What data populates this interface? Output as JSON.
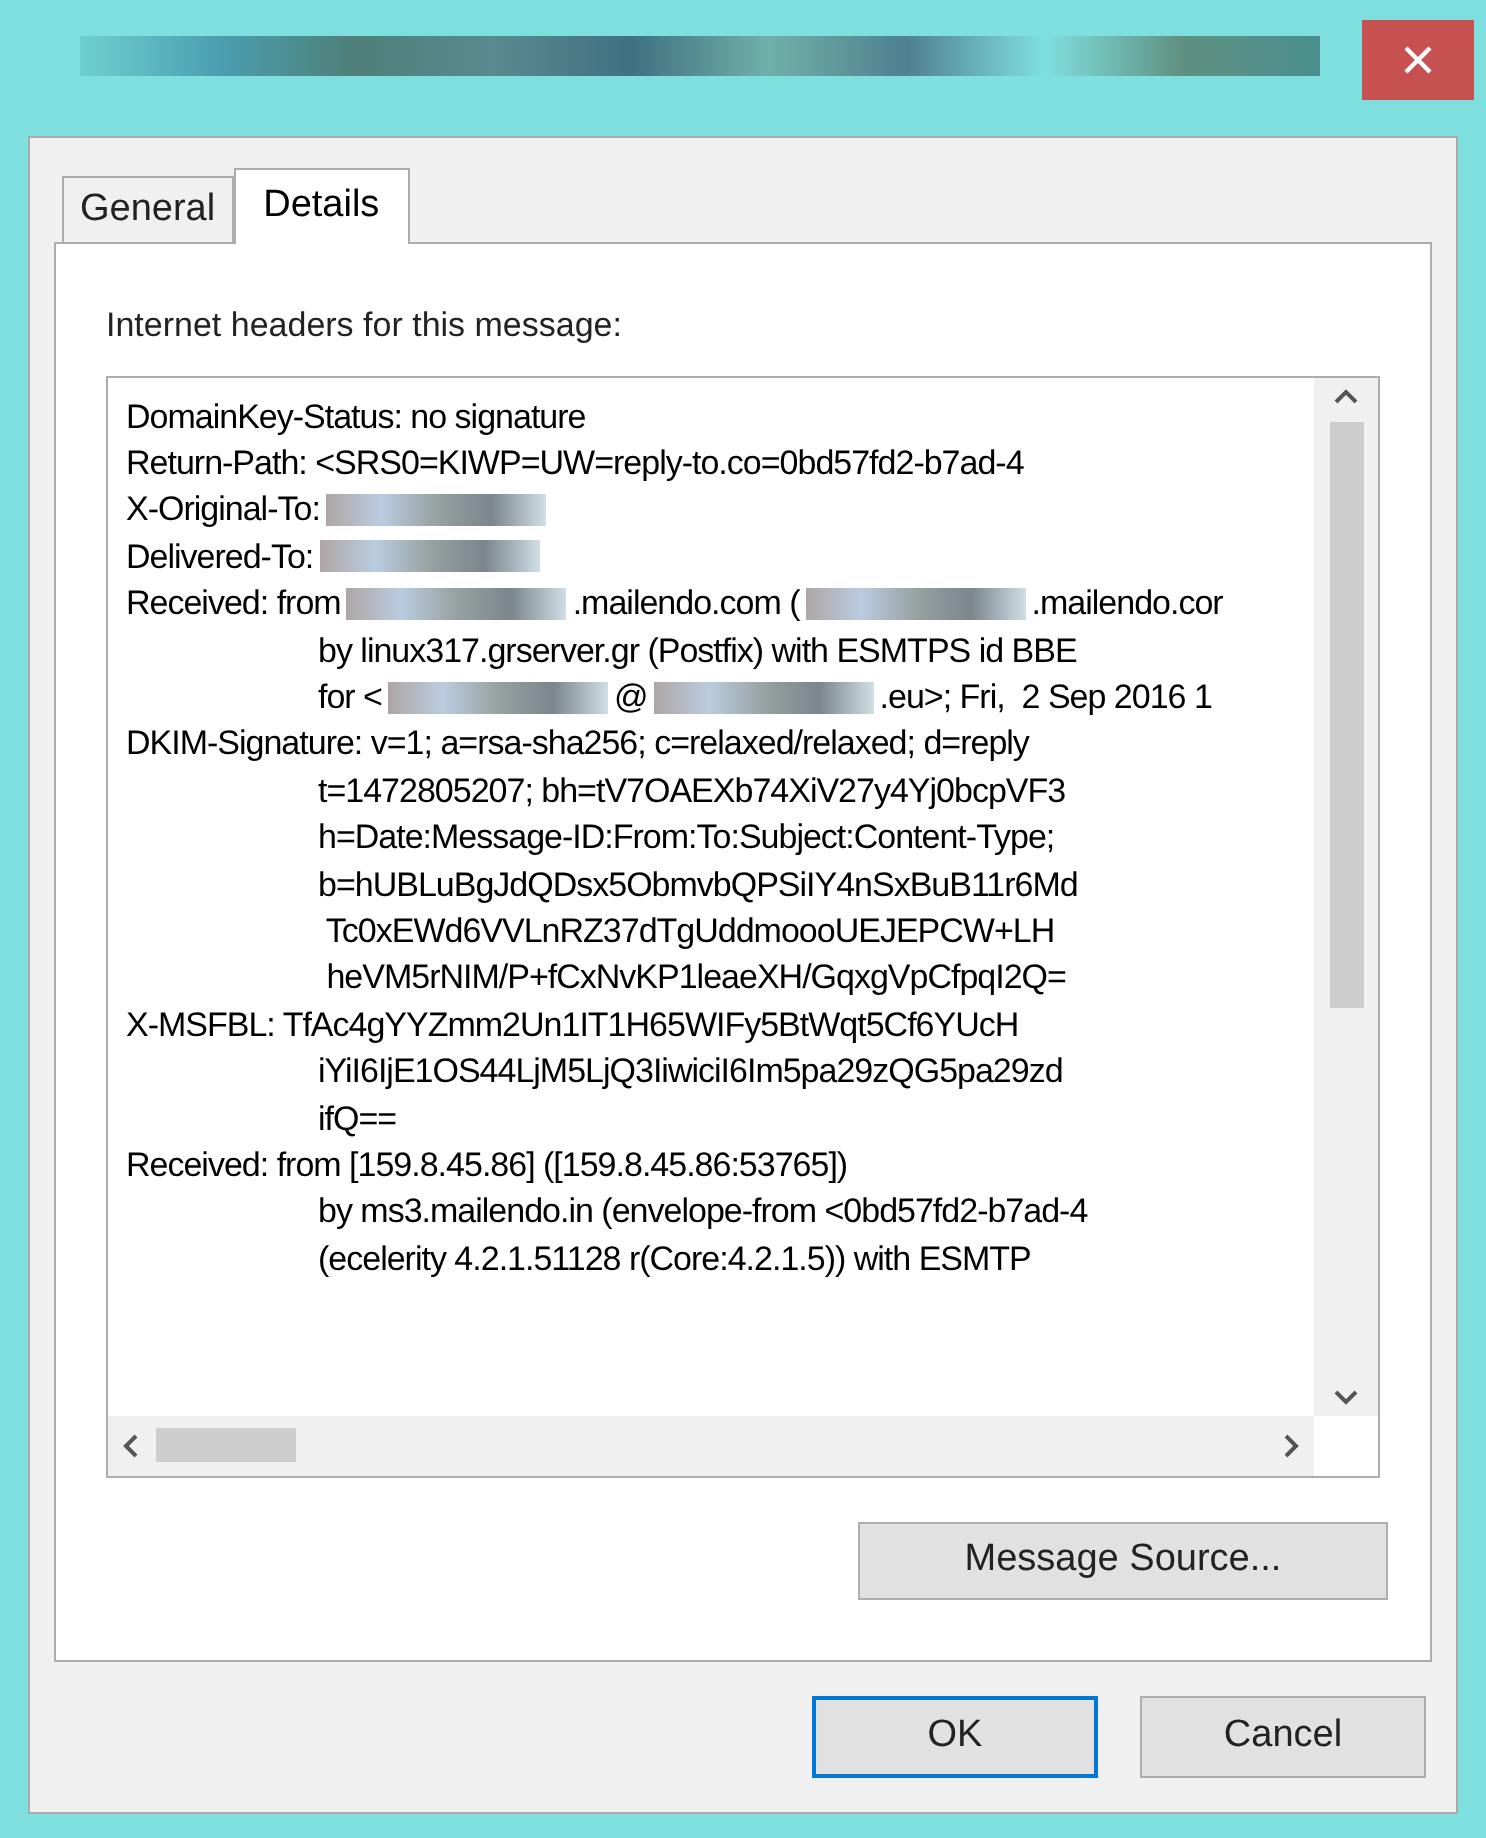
{
  "window": {
    "title_redacted": true
  },
  "tabs": [
    {
      "label": "General",
      "selected": false
    },
    {
      "label": "Details",
      "selected": true
    }
  ],
  "headers_label": "Internet headers for this message:",
  "headers": [
    {
      "lines": [
        [
          {
            "kind": "text",
            "text": "DomainKey-Status: no signature"
          }
        ]
      ]
    },
    {
      "lines": [
        [
          {
            "kind": "text",
            "text": "Return-Path: <SRS0=KIWP=UW=reply-to.co=0bd57fd2-b7ad-4"
          }
        ]
      ]
    },
    {
      "lines": [
        [
          {
            "kind": "text",
            "text": "X-Original-To:"
          },
          {
            "kind": "redacted"
          }
        ]
      ]
    },
    {
      "lines": [
        [
          {
            "kind": "text",
            "text": "Delivered-To:"
          },
          {
            "kind": "redacted"
          }
        ]
      ]
    },
    {
      "lines": [
        [
          {
            "kind": "text",
            "text": "Received: from"
          },
          {
            "kind": "redacted"
          },
          {
            "kind": "text",
            "text": ".mailendo.com ("
          },
          {
            "kind": "redacted"
          },
          {
            "kind": "text",
            "text": ".mailendo.cor"
          }
        ],
        [
          {
            "kind": "text",
            "text": "by linux317.grserver.gr (Postfix) with ESMTPS id BBE"
          }
        ],
        [
          {
            "kind": "text",
            "text": "for <"
          },
          {
            "kind": "redacted"
          },
          {
            "kind": "text",
            "text": "@"
          },
          {
            "kind": "redacted"
          },
          {
            "kind": "text",
            "text": ".eu>; Fri,  2 Sep 2016 1"
          }
        ]
      ]
    },
    {
      "lines": [
        [
          {
            "kind": "text",
            "text": "DKIM-Signature: v=1; a=rsa-sha256; c=relaxed/relaxed; d=reply"
          }
        ],
        [
          {
            "kind": "text",
            "text": "t=1472805207; bh=tV7OAEXb74XiV27y4Yj0bcpVF3"
          }
        ],
        [
          {
            "kind": "text",
            "text": "h=Date:Message-ID:From:To:Subject:Content-Type;"
          }
        ],
        [
          {
            "kind": "text",
            "text": "b=hUBLuBgJdQDsx5ObmvbQPSiIY4nSxBuB11r6Md"
          }
        ],
        [
          {
            "kind": "text",
            "text": " Tc0xEWd6VVLnRZ37dTgUddmoooUEJEPCW+LH"
          }
        ],
        [
          {
            "kind": "text",
            "text": " heVM5rNIM/P+fCxNvKP1leaeXH/GqxgVpCfpqI2Q="
          }
        ]
      ]
    },
    {
      "lines": [
        [
          {
            "kind": "text",
            "text": "X-MSFBL: TfAc4gYYZmm2Un1IT1H65WIFy5BtWqt5Cf6YUcH"
          }
        ],
        [
          {
            "kind": "text",
            "text": "iYiI6IjE1OS44LjM5LjQ3IiwiciI6Im5pa29zQG5pa29zd"
          }
        ],
        [
          {
            "kind": "text",
            "text": "ifQ=="
          }
        ]
      ]
    },
    {
      "lines": [
        [
          {
            "kind": "text",
            "text": "Received: from [159.8.45.86] ([159.8.45.86:53765])"
          }
        ],
        [
          {
            "kind": "text",
            "text": "by ms3.mailendo.in (envelope-from <0bd57fd2-b7ad-4"
          }
        ],
        [
          {
            "kind": "text",
            "text": "(ecelerity 4.2.1.51128 r(Core:4.2.1.5)) with ESMTP"
          }
        ]
      ]
    }
  ],
  "message_source_button": "Message Source...",
  "buttons": [
    "OK",
    "Cancel"
  ]
}
